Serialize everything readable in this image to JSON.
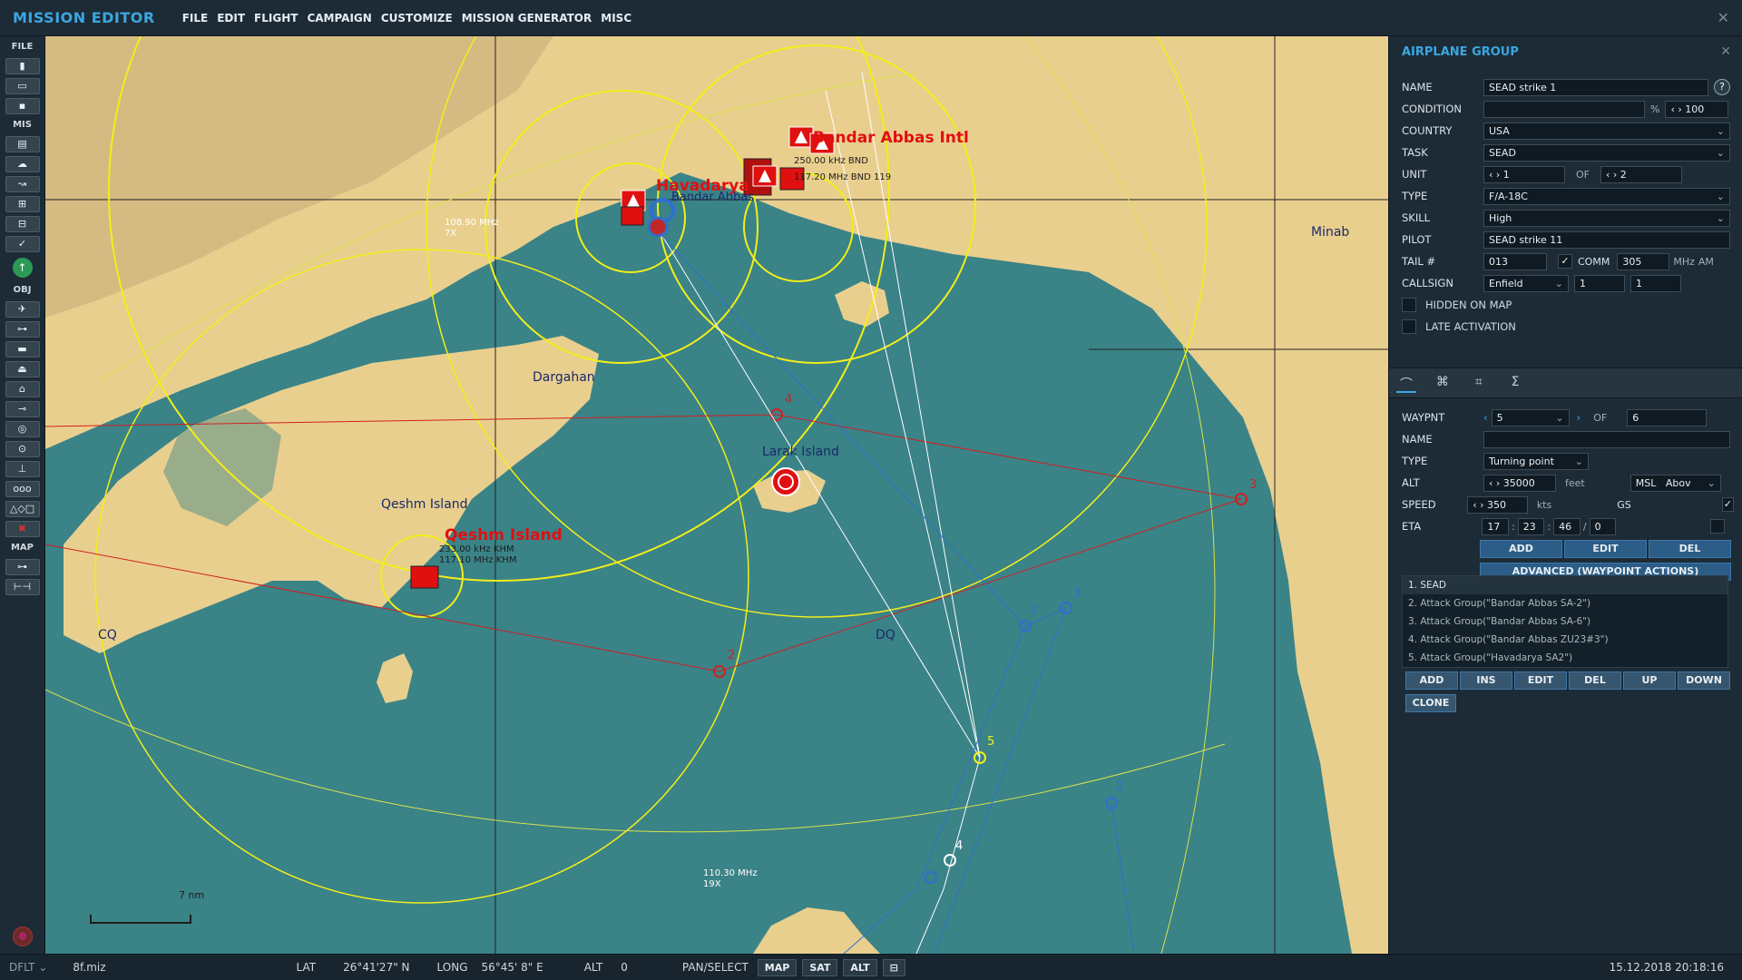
{
  "app": {
    "title": "MISSION EDITOR",
    "menu": [
      "FILE",
      "EDIT",
      "FLIGHT",
      "CAMPAIGN",
      "CUSTOMIZE",
      "MISSION GENERATOR",
      "MISC"
    ]
  },
  "leftbar": {
    "sections": {
      "file": "FILE",
      "mis": "MIS",
      "obj": "OBJ",
      "map": "MAP"
    }
  },
  "map": {
    "labels": {
      "bandar_abbas_intl": "Bandar Abbas Intl",
      "havadarya": "Havadarya",
      "bandar_abbas": "Bandar Abbas",
      "qeshm_island_red": "Qeshm Island",
      "qeshm_island": "Qeshm Island",
      "dargahan": "Dargahan",
      "larak_island": "Larak Island",
      "minab": "Minab",
      "cq": "CQ",
      "dq": "DQ"
    },
    "freqs": {
      "f1": "250.00 kHz BND",
      "f2": "117.20 MHz BND 119",
      "f3": "108.90 MHz",
      "f3b": "7X",
      "f4": "233.00 kHz KHM",
      "f5": "117.10 MHz KHM",
      "f6": "110.30 MHz",
      "f6b": "19X"
    },
    "scale": "7 nm",
    "waypoints": {
      "w2": "2",
      "w3": "3",
      "w4": "4",
      "w5": "5",
      "b2": "2",
      "b3": "3",
      "b4": "4",
      "b2b": "2"
    }
  },
  "panel": {
    "title": "AIRPLANE GROUP",
    "name_label": "NAME",
    "name_value": "SEAD strike 1",
    "condition_label": "CONDITION",
    "condition_pct": "%",
    "condition_value": "100",
    "country_label": "COUNTRY",
    "country_value": "USA",
    "task_label": "TASK",
    "task_value": "SEAD",
    "unit_label": "UNIT",
    "unit_value": "1",
    "unit_of": "OF",
    "unit_total": "2",
    "type_label": "TYPE",
    "type_value": "F/A-18C",
    "skill_label": "SKILL",
    "skill_value": "High",
    "pilot_label": "PILOT",
    "pilot_value": "SEAD strike 11",
    "tail_label": "TAIL #",
    "tail_value": "013",
    "comm_label": "COMM",
    "comm_value": "305",
    "comm_unit": "MHz",
    "comm_mod": "AM",
    "callsign_label": "CALLSIGN",
    "callsign_value": "Enfield",
    "callsign_n1": "1",
    "callsign_n2": "1",
    "hidden_label": "HIDDEN ON MAP",
    "late_label": "LATE ACTIVATION",
    "wp_label": "WAYPNT",
    "wp_value": "5",
    "wp_of": "OF",
    "wp_total": "6",
    "wp_name_label": "NAME",
    "wp_type_label": "TYPE",
    "wp_type_value": "Turning point",
    "alt_label": "ALT",
    "alt_value": "35000",
    "alt_unit": "feet",
    "alt_ref": "MSL",
    "alt_mode": "Abov",
    "speed_label": "SPEED",
    "speed_value": "350",
    "speed_unit": "kts",
    "gs_label": "GS",
    "eta_label": "ETA",
    "eta_h": "17",
    "eta_m": "23",
    "eta_s": "46",
    "eta_d": "0",
    "btn_add": "ADD",
    "btn_edit": "EDIT",
    "btn_del": "DEL",
    "btn_advanced": "ADVANCED (WAYPOINT ACTIONS)",
    "actions": [
      "1. SEAD",
      "2. Attack Group(\"Bandar Abbas SA-2\")",
      "3. Attack Group(\"Bandar Abbas SA-6\")",
      "4. Attack Group(\"Bandar Abbas ZU23#3\")",
      "5. Attack Group(\"Havadarya SA2\")"
    ],
    "act_add": "ADD",
    "act_ins": "INS",
    "act_edit": "EDIT",
    "act_del": "DEL",
    "act_up": "UP",
    "act_down": "DOWN",
    "act_clone": "CLONE"
  },
  "status": {
    "profile": "DFLT",
    "file": "8f.miz",
    "lat_label": "LAT",
    "lat_value": "26°41'27\" N",
    "long_label": "LONG",
    "long_value": "56°45' 8\" E",
    "alt_label": "ALT",
    "alt_value": "0",
    "mode": "PAN/SELECT",
    "btn_map": "MAP",
    "btn_sat": "SAT",
    "btn_alt": "ALT",
    "datetime": "15.12.2018 20:18:16"
  },
  "colors": {
    "sea": "#3a8387",
    "land": "#e9cf8e",
    "accent": "#3aa7e0",
    "yellow_circle": "#f2ee1a",
    "red": "#e01010",
    "blue_route": "#2f6fd0"
  }
}
